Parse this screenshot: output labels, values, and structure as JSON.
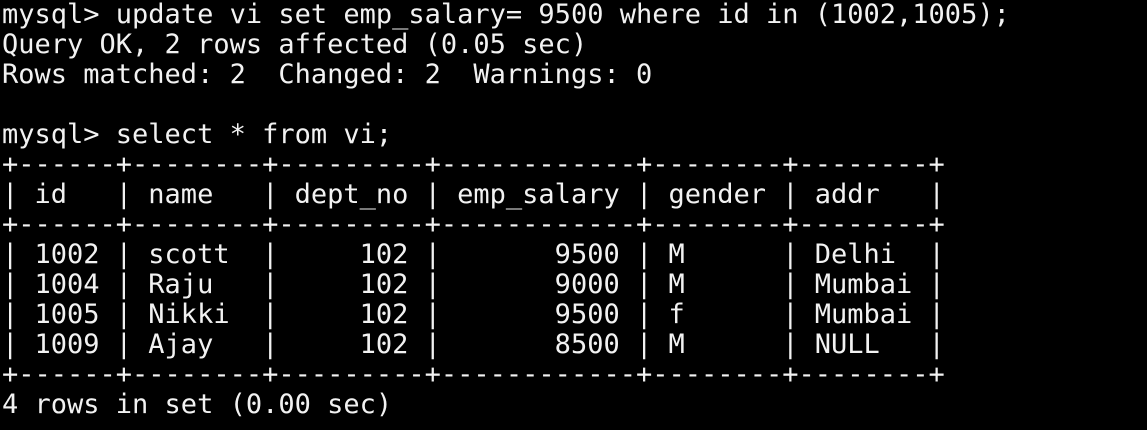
{
  "terminal": {
    "lines": [
      "mysql> update vi set emp_salary= 9500 where id in (1002,1005);",
      "Query OK, 2 rows affected (0.05 sec)",
      "Rows matched: 2  Changed: 2  Warnings: 0",
      "",
      "mysql> select * from vi;",
      "+------+--------+---------+------------+--------+--------+",
      "| id   | name   | dept_no | emp_salary | gender | addr   |",
      "+------+--------+---------+------------+--------+--------+",
      "| 1002 | scott  |     102 |       9500 | M      | Delhi  |",
      "| 1004 | Raju   |     102 |       9000 | M      | Mumbai |",
      "| 1005 | Nikki  |     102 |       9500 | f      | Mumbai |",
      "| 1009 | Ajay   |     102 |       8500 | M      | NULL   |",
      "+------+--------+---------+------------+--------+--------+",
      "4 rows in set (0.00 sec)"
    ]
  },
  "colors": {
    "background": "#000000",
    "text": "#f2f2f2"
  }
}
